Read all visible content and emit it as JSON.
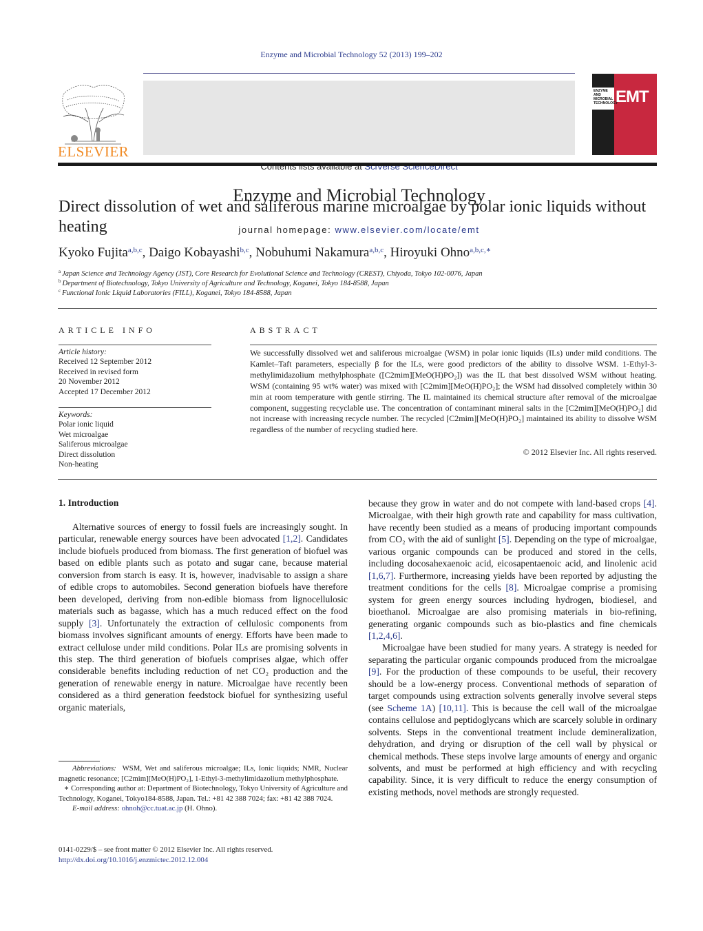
{
  "header": {
    "running_head": "Enzyme and Microbial Technology 52 (2013) 199–202",
    "contents_prefix": "Contents lists available at ",
    "contents_link": "SciVerse ScienceDirect",
    "journal_name": "Enzyme and Microbial Technology",
    "homepage_prefix": "journal homepage: ",
    "homepage_link": "www.elsevier.com/locate/emt",
    "publisher_logo_text": "ELSEVIER",
    "cover": {
      "journal_lines": [
        "ENZYME AND",
        "MICROBIAL",
        "TECHNOLOGY"
      ],
      "abbrev": "EMT",
      "colors": {
        "dark": "#1d1d1d",
        "red": "#c8283f"
      }
    },
    "colors": {
      "link": "#2a3a8c",
      "logo_orange": "#f08a24",
      "banner_bg": "#e6e6e6"
    }
  },
  "article": {
    "title": "Direct dissolution of wet and saliferous marine microalgae by polar ionic liquids without heating",
    "authors": [
      {
        "name": "Kyoko Fujita",
        "affil": "a,b,c"
      },
      {
        "name": "Daigo Kobayashi",
        "affil": "b,c"
      },
      {
        "name": "Nobuhumi Nakamura",
        "affil": "a,b,c"
      },
      {
        "name": "Hiroyuki Ohno",
        "affil": "a,b,c,∗"
      }
    ],
    "affiliations": [
      {
        "mark": "a",
        "text": "Japan Science and Technology Agency (JST), Core Research for Evolutional Science and Technology (CREST), Chiyoda, Tokyo 102-0076, Japan"
      },
      {
        "mark": "b",
        "text": "Department of Biotechnology, Tokyo University of Agriculture and Technology, Koganei, Tokyo 184-8588, Japan"
      },
      {
        "mark": "c",
        "text": "Functional Ionic Liquid Laboratories (FILL), Koganei, Tokyo 184-8588, Japan"
      }
    ]
  },
  "article_info": {
    "heading": "ARTICLE INFO",
    "history_label": "Article history:",
    "history": [
      "Received 12 September 2012",
      "Received in revised form",
      "20 November 2012",
      "Accepted 17 December 2012"
    ],
    "keywords_label": "Keywords:",
    "keywords": [
      "Polar ionic liquid",
      "Wet microalgae",
      "Saliferous microalgae",
      "Direct dissolution",
      "Non-heating"
    ]
  },
  "abstract": {
    "heading": "ABSTRACT",
    "text": "We successfully dissolved wet and saliferous microalgae (WSM) in polar ionic liquids (ILs) under mild conditions. The Kamlet–Taft parameters, especially β for the ILs, were good predictors of the ability to dissolve WSM. 1-Ethyl-3-methylimidazolium methylphosphate ([C2mim][MeO(H)PO₂]) was the IL that best dissolved WSM without heating. WSM (containing 95 wt% water) was mixed with [C2mim][MeO(H)PO₂]; the WSM had dissolved completely within 30 min at room temperature with gentle stirring. The IL maintained its chemical structure after removal of the microalgae component, suggesting recyclable use. The concentration of contaminant mineral salts in the [C2mim][MeO(H)PO₂] did not increase with increasing recycle number. The recycled [C2mim][MeO(H)PO₂] maintained its ability to dissolve WSM regardless of the number of recycling studied here.",
    "copyright": "© 2012 Elsevier Inc. All rights reserved."
  },
  "body": {
    "section_heading": "1.  Introduction",
    "left_col": {
      "p1": [
        {
          "t": "Alternative sources of energy to fossil fuels are increasingly sought. In particular, renewable energy sources have been advocated "
        },
        {
          "ref": "[1,2]"
        },
        {
          "t": ". Candidates include biofuels produced from biomass. The first generation of biofuel was based on edible plants such as potato and sugar cane, because material conversion from starch is easy. It is, however, inadvisable to assign a share of edible crops to automobiles. Second generation biofuels have therefore been developed, deriving from non-edible biomass from lignocellulosic materials such as bagasse, which has a much reduced effect on the food supply "
        },
        {
          "ref": "[3]"
        },
        {
          "t": ". Unfortunately the extraction of cellulosic components from biomass involves significant amounts of energy. Efforts have been made to extract cellulose under mild conditions. Polar ILs are promising solvents in this step. The third generation of biofuels comprises algae, which offer considerable benefits including reduction of net CO₂ production and the generation of renewable energy in nature. Microalgae have recently been considered as a third generation feedstock biofuel for synthesizing useful organic materials,"
        }
      ]
    },
    "right_col": {
      "p1": [
        {
          "t": "because they grow in water and do not compete with land-based crops "
        },
        {
          "ref": "[4]"
        },
        {
          "t": ". Microalgae, with their high growth rate and capability for mass cultivation, have recently been studied as a means of producing important compounds from CO₂ with the aid of sunlight "
        },
        {
          "ref": "[5]"
        },
        {
          "t": ". Depending on the type of microalgae, various organic compounds can be produced and stored in the cells, including docosahexaenoic acid, eicosapentaenoic acid, and linolenic acid "
        },
        {
          "ref": "[1,6,7]"
        },
        {
          "t": ". Furthermore, increasing yields have been reported by adjusting the treatment conditions for the cells "
        },
        {
          "ref": "[8]"
        },
        {
          "t": ". Microalgae comprise a promising system for green energy sources including hydrogen, biodiesel, and bioethanol. Microalgae are also promising materials in bio-refining, generating organic compounds such as bio-plastics and fine chemicals "
        },
        {
          "ref": "[1,2,4,6]"
        },
        {
          "t": "."
        }
      ],
      "p2": [
        {
          "t": "Microalgae have been studied for many years. A strategy is needed for separating the particular organic compounds produced from the microalgae "
        },
        {
          "ref": "[9]"
        },
        {
          "t": ". For the production of these compounds to be useful, their recovery should be a low-energy process. Conventional methods of separation of target compounds using extraction solvents generally involve several steps (see "
        },
        {
          "ref": "Scheme 1A"
        },
        {
          "t": ") "
        },
        {
          "ref": "[10,11]"
        },
        {
          "t": ". This is because the cell wall of the microalgae contains cellulose and peptidoglycans which are scarcely soluble in ordinary solvents. Steps in the conventional treatment include demineralization, dehydration, and drying or disruption of the cell wall by physical or chemical methods. These steps involve large amounts of energy and organic solvents, and must be performed at high efficiency and with recycling capability. Since, it is very difficult to reduce the energy consumption of existing methods, novel methods are strongly requested."
        }
      ]
    }
  },
  "footnotes": {
    "abbreviations_label": "Abbreviations:",
    "abbreviations": "WSM, Wet and saliferous microalgae; ILs, Ionic liquids; NMR, Nuclear magnetic resonance; [C2mim][MeO(H)PO₂], 1-Ethyl-3-methylimidazolium methylphosphate.",
    "corresponding": "∗ Corresponding author at: Department of Biotechnology, Tokyo University of Agriculture and Technology, Koganei, Tokyo184-8588, Japan. Tel.: +81 42 388 7024; fax: +81 42 388 7024.",
    "email_label": "E-mail address:",
    "email": "ohnoh@cc.tuat.ac.jp",
    "email_suffix": " (H. Ohno)."
  },
  "front_matter": {
    "issn_line": "0141-0229/$ – see front matter © 2012 Elsevier Inc. All rights reserved.",
    "doi": "http://dx.doi.org/10.1016/j.enzmictec.2012.12.004"
  }
}
